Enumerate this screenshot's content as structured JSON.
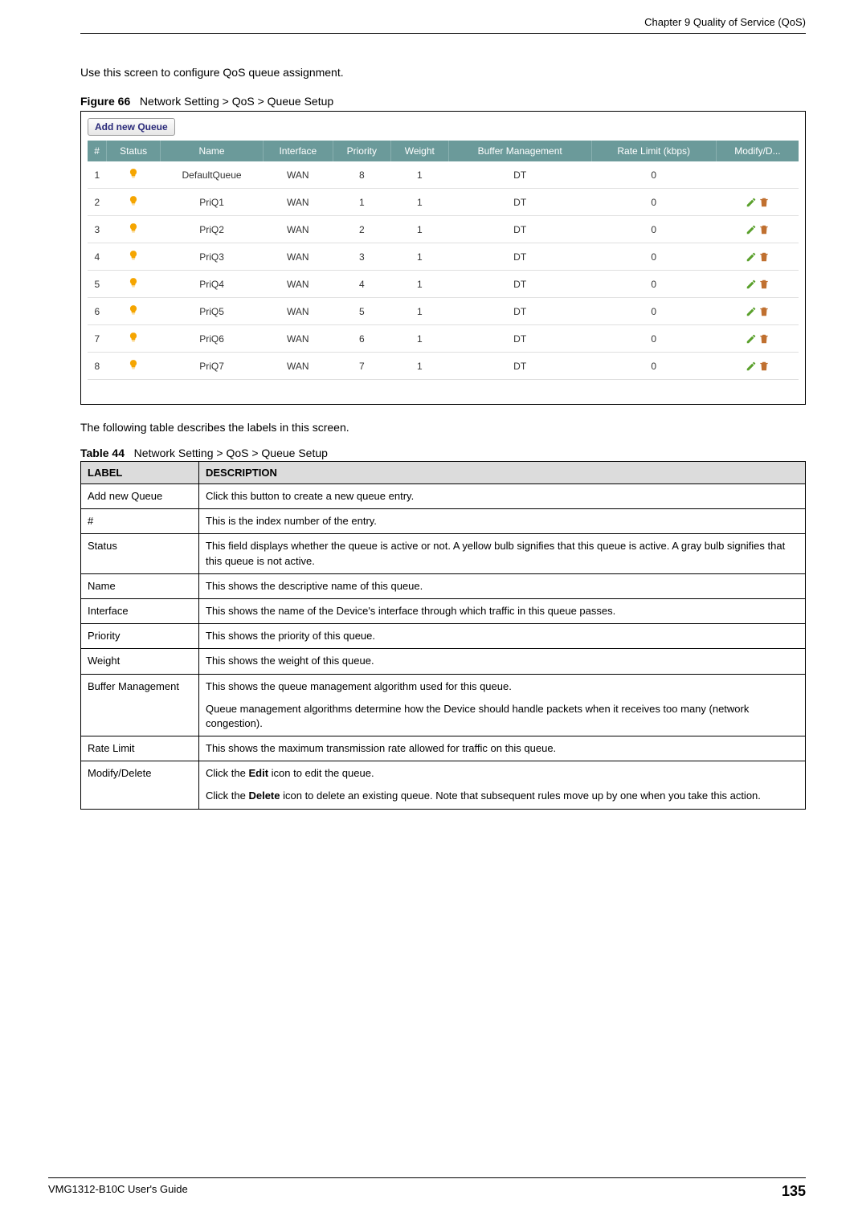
{
  "chapter_title": "Chapter 9 Quality of Service (QoS)",
  "intro_text": "Use this screen to configure QoS queue assignment.",
  "figure_label": "Figure 66",
  "figure_title": "Network Setting > QoS > Queue Setup",
  "add_queue_button": "Add new Queue",
  "queue_headers": [
    "#",
    "Status",
    "Name",
    "Interface",
    "Priority",
    "Weight",
    "Buffer Management",
    "Rate Limit (kbps)",
    "Modify/D..."
  ],
  "queue_rows": [
    {
      "num": "1",
      "name": "DefaultQueue",
      "interface": "WAN",
      "priority": "8",
      "weight": "1",
      "buffer": "DT",
      "rate": "0",
      "modifiable": false
    },
    {
      "num": "2",
      "name": "PriQ1",
      "interface": "WAN",
      "priority": "1",
      "weight": "1",
      "buffer": "DT",
      "rate": "0",
      "modifiable": true
    },
    {
      "num": "3",
      "name": "PriQ2",
      "interface": "WAN",
      "priority": "2",
      "weight": "1",
      "buffer": "DT",
      "rate": "0",
      "modifiable": true
    },
    {
      "num": "4",
      "name": "PriQ3",
      "interface": "WAN",
      "priority": "3",
      "weight": "1",
      "buffer": "DT",
      "rate": "0",
      "modifiable": true
    },
    {
      "num": "5",
      "name": "PriQ4",
      "interface": "WAN",
      "priority": "4",
      "weight": "1",
      "buffer": "DT",
      "rate": "0",
      "modifiable": true
    },
    {
      "num": "6",
      "name": "PriQ5",
      "interface": "WAN",
      "priority": "5",
      "weight": "1",
      "buffer": "DT",
      "rate": "0",
      "modifiable": true
    },
    {
      "num": "7",
      "name": "PriQ6",
      "interface": "WAN",
      "priority": "6",
      "weight": "1",
      "buffer": "DT",
      "rate": "0",
      "modifiable": true
    },
    {
      "num": "8",
      "name": "PriQ7",
      "interface": "WAN",
      "priority": "7",
      "weight": "1",
      "buffer": "DT",
      "rate": "0",
      "modifiable": true
    }
  ],
  "post_figure_text": "The following table describes the labels in this screen.",
  "table_label": "Table 44",
  "table_title": "Network Setting > QoS > Queue Setup",
  "desc_headers": {
    "label": "LABEL",
    "description": "DESCRIPTION"
  },
  "desc_rows": [
    {
      "label": "Add new Queue",
      "desc": "Click this button to create a new queue entry."
    },
    {
      "label": "#",
      "desc": "This is the index number of the entry."
    },
    {
      "label": "Status",
      "desc": "This field displays whether the queue is active or not. A yellow bulb signifies that this queue is active. A gray bulb signifies that this queue is not active."
    },
    {
      "label": "Name",
      "desc": "This shows the descriptive name of this queue."
    },
    {
      "label": "Interface",
      "desc": "This shows the name of the Device's interface through which traffic in this queue passes."
    },
    {
      "label": "Priority",
      "desc": "This shows the priority of this queue."
    },
    {
      "label": "Weight",
      "desc": "This shows the weight of this queue."
    },
    {
      "label": "Buffer Management",
      "desc": "This shows the queue management algorithm used for this queue.\n\nQueue management algorithms determine how the Device should handle packets when it receives too many (network congestion)."
    },
    {
      "label": "Rate Limit",
      "desc": "This shows the maximum transmission rate allowed for traffic on this queue."
    },
    {
      "label": "Modify/Delete",
      "desc_html": true,
      "desc": "Click the <b>Edit</b> icon to edit the queue.\n\nClick the <b>Delete</b> icon to delete an existing queue. Note that subsequent rules move up by one when you take this action."
    }
  ],
  "footer_guide": "VMG1312-B10C User's Guide",
  "footer_page": "135"
}
